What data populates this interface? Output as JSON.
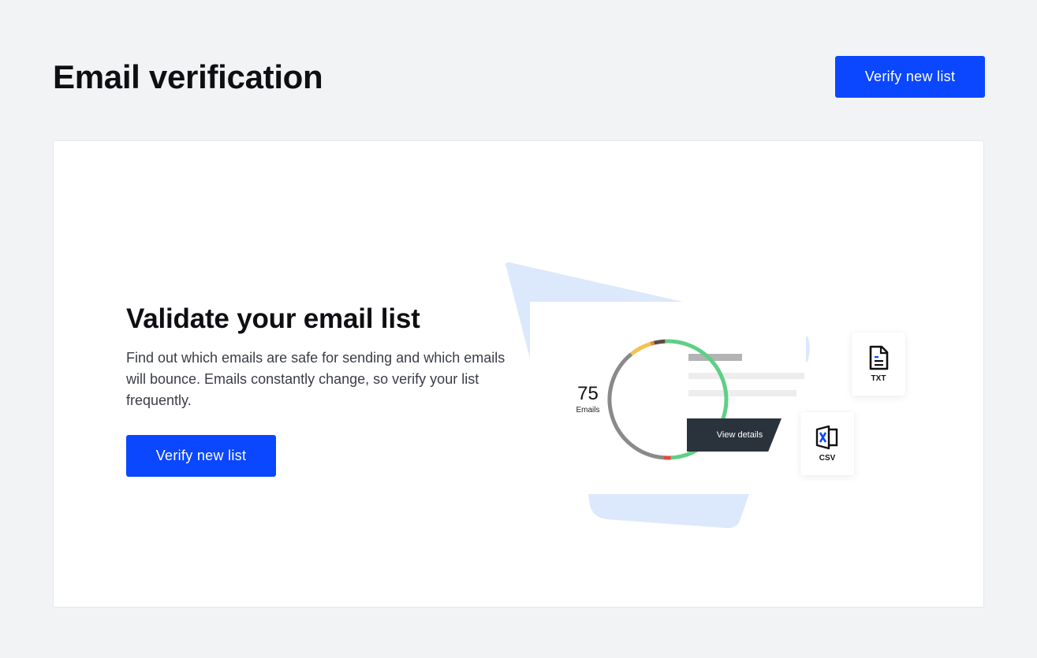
{
  "header": {
    "title": "Email verification",
    "verify_button": "Verify new list"
  },
  "card": {
    "title": "Validate your email list",
    "description": "Find out which emails are safe for sending and which emails will bounce. Emails constantly change, so verify your list frequently.",
    "verify_button": "Verify new list"
  },
  "illustration": {
    "ring_count": "75",
    "ring_label": "Emails",
    "view_details": "View details",
    "file_txt": "TXT",
    "file_csv": "CSV",
    "ring_segments": [
      {
        "color": "#5fcf86",
        "fraction": 0.5
      },
      {
        "color": "#e24b3d",
        "fraction": 0.02
      },
      {
        "color": "#8a8a8a",
        "fraction": 0.38
      },
      {
        "color": "#f3c254",
        "fraction": 0.06
      },
      {
        "color": "#e8873a",
        "fraction": 0.01
      },
      {
        "color": "#5a4a46",
        "fraction": 0.03
      }
    ]
  },
  "colors": {
    "accent": "#0a47ff",
    "background": "#f2f3f5",
    "card": "#ffffff",
    "shape": "#dce8fb"
  }
}
